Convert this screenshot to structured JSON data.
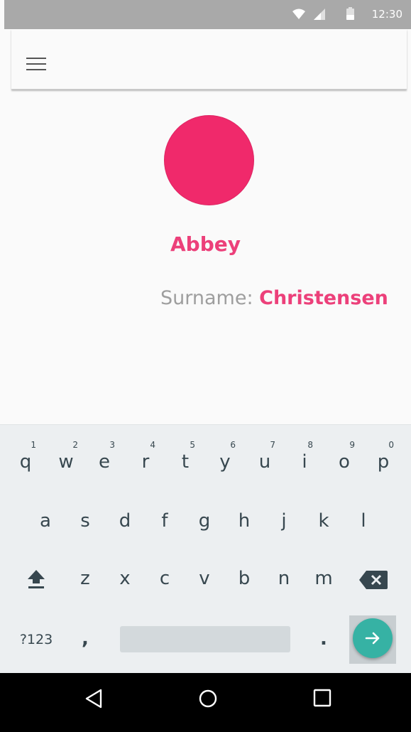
{
  "status_bar": {
    "time": "12:30",
    "icons": [
      "wifi-icon",
      "signal-icon",
      "battery-icon"
    ]
  },
  "app_bar": {
    "menu_icon": "hamburger-menu-icon"
  },
  "profile": {
    "name": "Abbey",
    "surname_label": "Surname: ",
    "surname_value": "Christensen",
    "avatar_color": "#f0296b",
    "accent_color": "#ec407a"
  },
  "keyboard": {
    "row1": [
      {
        "letter": "q",
        "hint": "1"
      },
      {
        "letter": "w",
        "hint": "2"
      },
      {
        "letter": "e",
        "hint": "3"
      },
      {
        "letter": "r",
        "hint": "4"
      },
      {
        "letter": "t",
        "hint": "5"
      },
      {
        "letter": "y",
        "hint": "6"
      },
      {
        "letter": "u",
        "hint": "7"
      },
      {
        "letter": "i",
        "hint": "8"
      },
      {
        "letter": "o",
        "hint": "9"
      },
      {
        "letter": "p",
        "hint": "0"
      }
    ],
    "row2": [
      "a",
      "s",
      "d",
      "f",
      "g",
      "h",
      "j",
      "k",
      "l"
    ],
    "row3": [
      "z",
      "x",
      "c",
      "v",
      "b",
      "n",
      "m"
    ],
    "symbols_label": "?123",
    "comma": ",",
    "period": ".",
    "enter_color": "#36b2a4"
  },
  "nav_bar": {
    "back": "back-icon",
    "home": "home-icon",
    "recents": "recents-icon"
  }
}
